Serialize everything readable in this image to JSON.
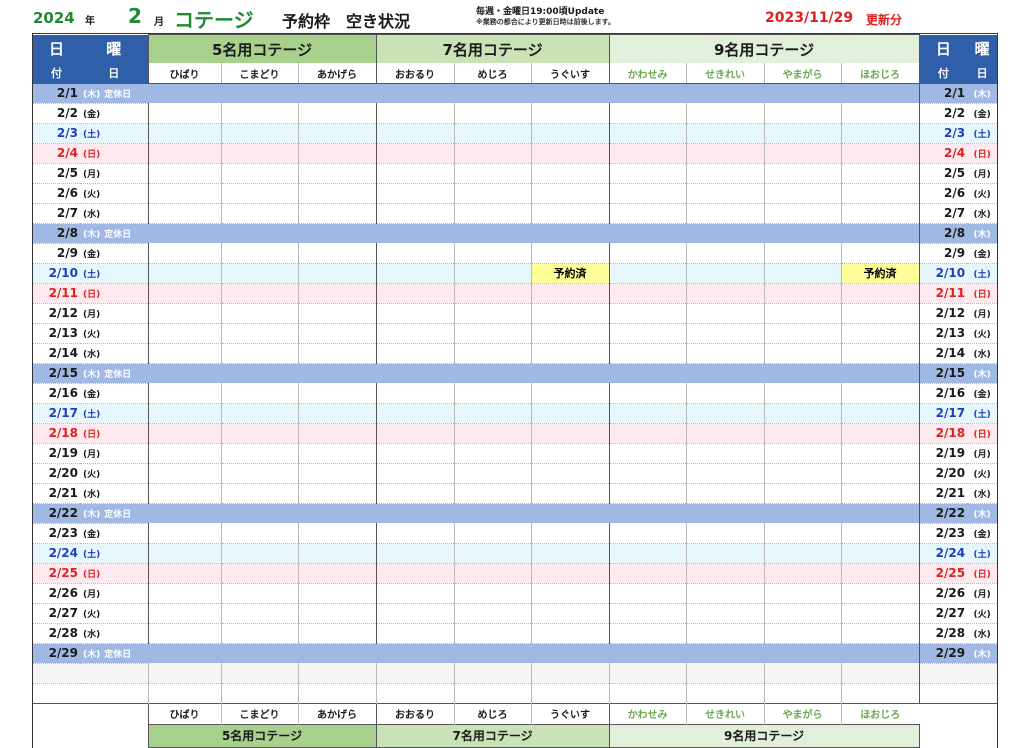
{
  "header": {
    "year": "2024",
    "year_unit": "年",
    "month": "2",
    "month_unit": "月",
    "title": "コテージ",
    "subtitle": "予約枠　空き状況",
    "update_note": "毎週・金曜日19:00頃Update",
    "update_sub": "※業務の都合により更新日時は前後します。",
    "updated_date": "2023/11/29",
    "updated_label": "更新分"
  },
  "columns": {
    "day_label_1": "日",
    "day_label_2": "付",
    "dow_label_1": "曜",
    "dow_label_2": "日",
    "groups": [
      {
        "name": "5名用コテージ",
        "cottages": [
          "ひばり",
          "こまどり",
          "あかげら"
        ]
      },
      {
        "name": "7名用コテージ",
        "cottages": [
          "おおるり",
          "めじろ",
          "うぐいす"
        ]
      },
      {
        "name": "9名用コテージ",
        "cottages": [
          "かわせみ",
          "せきれい",
          "やまがら",
          "ほおじろ"
        ]
      }
    ]
  },
  "closed_label": "定休日",
  "booked_label": "予約済",
  "colors": {
    "header_blue": "#2e5fa8",
    "closed_row": "#9fb9e4",
    "saturday_text": "#1f3fbf",
    "sunday_text": "#e0201f",
    "booked_fill": "#ffff99",
    "title_green": "#1e8a32"
  },
  "days": [
    {
      "date": "2/1",
      "dow": "(木)",
      "type": "closed"
    },
    {
      "date": "2/2",
      "dow": "(金)",
      "type": "normal"
    },
    {
      "date": "2/3",
      "dow": "(土)",
      "type": "sat"
    },
    {
      "date": "2/4",
      "dow": "(日)",
      "type": "sun"
    },
    {
      "date": "2/5",
      "dow": "(月)",
      "type": "normal"
    },
    {
      "date": "2/6",
      "dow": "(火)",
      "type": "normal"
    },
    {
      "date": "2/7",
      "dow": "(水)",
      "type": "normal"
    },
    {
      "date": "2/8",
      "dow": "(木)",
      "type": "closed"
    },
    {
      "date": "2/9",
      "dow": "(金)",
      "type": "normal"
    },
    {
      "date": "2/10",
      "dow": "(土)",
      "type": "sat",
      "booked": [
        5,
        9
      ]
    },
    {
      "date": "2/11",
      "dow": "(日)",
      "type": "sun"
    },
    {
      "date": "2/12",
      "dow": "(月)",
      "type": "normal"
    },
    {
      "date": "2/13",
      "dow": "(火)",
      "type": "normal"
    },
    {
      "date": "2/14",
      "dow": "(水)",
      "type": "normal"
    },
    {
      "date": "2/15",
      "dow": "(木)",
      "type": "closed"
    },
    {
      "date": "2/16",
      "dow": "(金)",
      "type": "normal"
    },
    {
      "date": "2/17",
      "dow": "(土)",
      "type": "sat"
    },
    {
      "date": "2/18",
      "dow": "(日)",
      "type": "sun"
    },
    {
      "date": "2/19",
      "dow": "(月)",
      "type": "normal"
    },
    {
      "date": "2/20",
      "dow": "(火)",
      "type": "normal"
    },
    {
      "date": "2/21",
      "dow": "(水)",
      "type": "normal"
    },
    {
      "date": "2/22",
      "dow": "(木)",
      "type": "closed"
    },
    {
      "date": "2/23",
      "dow": "(金)",
      "type": "normal"
    },
    {
      "date": "2/24",
      "dow": "(土)",
      "type": "sat"
    },
    {
      "date": "2/25",
      "dow": "(日)",
      "type": "sun"
    },
    {
      "date": "2/26",
      "dow": "(月)",
      "type": "normal"
    },
    {
      "date": "2/27",
      "dow": "(火)",
      "type": "normal"
    },
    {
      "date": "2/28",
      "dow": "(水)",
      "type": "normal"
    },
    {
      "date": "2/29",
      "dow": "(木)",
      "type": "closed"
    }
  ]
}
